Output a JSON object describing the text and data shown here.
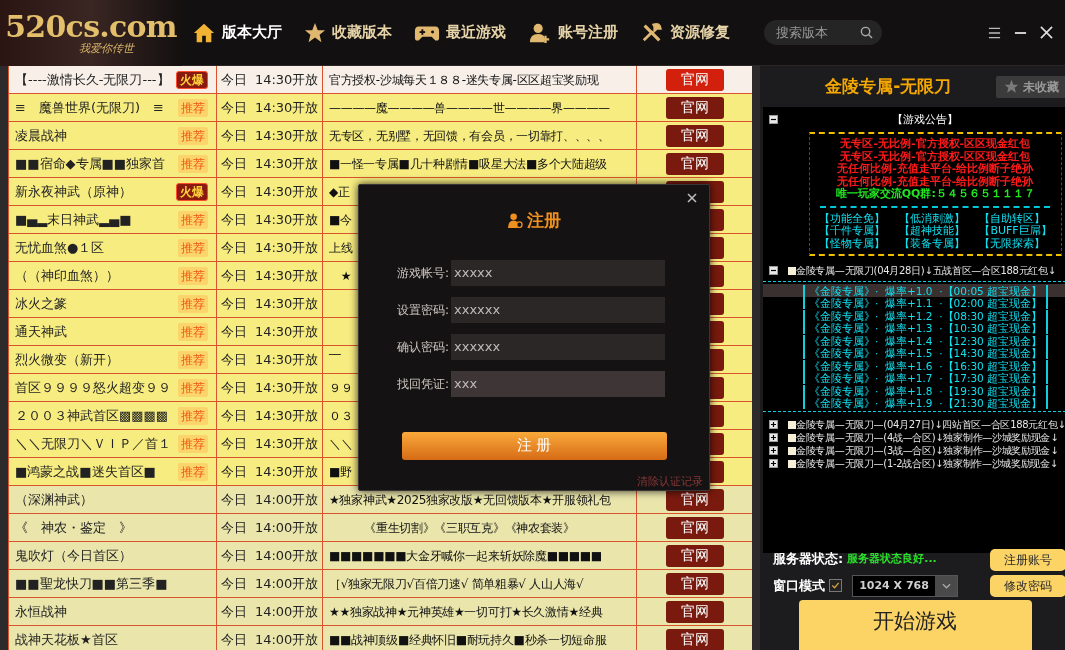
{
  "header": {
    "logo": {
      "text": "520cs.com",
      "tagline": "我爱你传世"
    },
    "nav": [
      {
        "label": "版本大厅",
        "selected": true
      },
      {
        "label": "收藏版本",
        "selected": false
      },
      {
        "label": "最近游戏",
        "selected": false
      },
      {
        "label": "账号注册",
        "selected": false
      },
      {
        "label": "资源修复",
        "selected": false
      }
    ],
    "search": {
      "placeholder": "搜索版本"
    }
  },
  "servers": [
    {
      "name": "【----激情长久-无限刀---】",
      "badge": {
        "kind": "hot",
        "text": "火爆"
      },
      "time": "今日  14:30开放",
      "desc": "官方授权-沙城每天１８８-迷失专属-区区超宝奖励现",
      "button": "官网",
      "selected": true
    },
    {
      "name": "≡　魔兽世界(无限刀)　≡",
      "badge": {
        "kind": "recommended",
        "text": "推荐"
      },
      "time": "今日  14:30开放",
      "desc": "————魔————兽————世————界————",
      "button": "官网",
      "selected": false
    },
    {
      "name": "凌晨战神",
      "badge": {
        "kind": "recommended",
        "text": "推荐"
      },
      "time": "今日  14:30开放",
      "desc": "无专区，无别墅，无回馈，有会员，一切靠打、、、、",
      "button": "官网",
      "selected": false
    },
    {
      "name": "■■宿命◆专属■■独家首",
      "badge": {
        "kind": "recommended",
        "text": "推荐"
      },
      "time": "今日  14:30开放",
      "desc": "■一怪一专属■几十种剧情■吸星大法■多个大陆超级",
      "button": "官网",
      "selected": false
    },
    {
      "name": "新永夜神武（原神）",
      "badge": {
        "kind": "hot",
        "text": "火爆"
      },
      "time": "今日  14:30开放",
      "desc": "◆正",
      "selected": false
    },
    {
      "name": "■▄▂末日神武▂▄■",
      "badge": {
        "kind": "recommended",
        "text": "推荐"
      },
      "time": "今日  14:30开放",
      "desc": "■今",
      "selected": false
    },
    {
      "name": "无忧血煞●１区",
      "badge": {
        "kind": "recommended",
        "text": "推荐"
      },
      "time": "今日  14:30开放",
      "desc": "上线",
      "selected": false
    },
    {
      "name": "（（神印血煞））",
      "badge": {
        "kind": "recommended",
        "text": "推荐"
      },
      "time": "今日  14:30开放",
      "desc": "　★",
      "selected": false
    },
    {
      "name": "冰火之篆",
      "badge": {
        "kind": "recommended",
        "text": "推荐"
      },
      "time": "今日  14:30开放",
      "selected": false
    },
    {
      "name": "通天神武",
      "badge": {
        "kind": "recommended",
        "text": "推荐"
      },
      "time": "今日  14:30开放",
      "selected": false
    },
    {
      "name": "烈火微变（新开）",
      "badge": {
        "kind": "recommended",
        "text": "推荐"
      },
      "time": "今日  14:30开放",
      "desc": "‾‾",
      "selected": false
    },
    {
      "name": "首区９９９９怒火超变９９",
      "badge": {
        "kind": "recommended",
        "text": "推荐"
      },
      "time": "今日  14:30开放",
      "desc": "９９",
      "selected": false
    },
    {
      "name": "２００３神武首区▩▩▩▩",
      "badge": {
        "kind": "recommended",
        "text": "推荐"
      },
      "time": "今日  14:30开放",
      "desc": "０３",
      "selected": false
    },
    {
      "name": "＼＼无限刀＼ＶＩＰ／首１",
      "badge": {
        "kind": "recommended",
        "text": "推荐"
      },
      "time": "今日  14:30开放",
      "desc": "＼＼",
      "selected": false
    },
    {
      "name": "■鸿蒙之战■迷失首区■",
      "badge": {
        "kind": "recommended",
        "text": "推荐"
      },
      "time": "今日  14:30开放",
      "desc": "■野",
      "selected": false
    },
    {
      "name": "（深渊神武）",
      "time": "今日  14:00开放",
      "desc": "★独家神武★2025独家改版★无回馈版本★开服领礼包",
      "button": "官网",
      "selected": false
    },
    {
      "name": "《　神农・鉴定　》",
      "time": "今日  14:00开放",
      "desc": "　　　《重生切割》《三职互克》《神农套装》",
      "button": "官网",
      "selected": false
    },
    {
      "name": "鬼吹灯（今日首区）",
      "time": "今日  14:00开放",
      "desc": "■■■■■■■大金牙喊你一起来斩妖除魔■■■■■",
      "button": "官网",
      "selected": false
    },
    {
      "name": "■■聖龙快刀■■第三季■",
      "time": "今日  14:00开放",
      "desc": "［√独家无限刀√百倍刀速√ 简单粗暴√ 人山人海√",
      "button": "官网",
      "selected": false
    },
    {
      "name": "永恒战神",
      "time": "今日  14:00开放",
      "desc": "★★独家战神★元神英雄★一切可打★长久激情★经典",
      "button": "官网",
      "selected": false
    },
    {
      "name": "战神天花板★首区",
      "time": "今日  14:00开放",
      "desc": "■■战神顶级■经典怀旧■耐玩持久■秒杀一切短命服",
      "button": "官网",
      "selected": false
    }
  ],
  "register_dialog": {
    "title": "注册",
    "fields": [
      {
        "label": "游戏帐号:",
        "value": "xxxxx",
        "focused": false
      },
      {
        "label": "设置密码:",
        "value": "xxxxxx",
        "focused": false
      },
      {
        "label": "确认密码:",
        "value": "xxxxxx",
        "focused": false
      },
      {
        "label": "找回凭证:",
        "value": "xxx",
        "focused": true
      }
    ],
    "submit": "注 册",
    "clear_link": "清除认证记录"
  },
  "game": {
    "title": "金陵专属-无限刀",
    "favorite": {
      "label": "未收藏",
      "favorited": false
    },
    "notice": [
      {
        "kind": "announcement",
        "label": "【游戏公告】",
        "expanded": true,
        "lines": [
          {
            "text": "无专区-无比例-官方授权-区区现金红包",
            "color": "#ff1a1a"
          },
          {
            "text": "无专区-无比例-官方授权-区区现金红包",
            "color": "#ff1a1a"
          },
          {
            "text": "无任何比例-充值走平台-给比例断子绝孙",
            "color": "#ff1a1a"
          },
          {
            "text": "无任何比例-充值走平台-给比例断子绝孙",
            "color": "#ff1a1a"
          },
          {
            "text": "唯一玩家交流QQ群:５４５６５１１１７",
            "color": "#22e622"
          }
        ],
        "tags": [
          "【功能全免】",
          "【低消刺激】",
          "【自助转区】",
          "【千件专属】",
          "【超神技能】",
          "【BUFF巨屌】",
          "【怪物专属】",
          "【装备专属】",
          "【无限探索】"
        ]
      },
      {
        "kind": "schedule",
        "label": "金陵专属—无限刀(04月28日)↓五战首区—合区188元红包↓",
        "expanded": true,
        "rows": [
          {
            "text": "《金陵专属》·  爆率+1.0  ·【00:05 超宝现金】",
            "selected": true
          },
          {
            "text": "《金陵专属》·  爆率+1.1  ·【02:00 超宝现金】",
            "selected": false
          },
          {
            "text": "《金陵专属》·  爆率+1.2  ·【08:30 超宝现金】",
            "selected": false
          },
          {
            "text": "《金陵专属》·  爆率+1.3  ·【10:30 超宝现金】",
            "selected": false
          },
          {
            "text": "《金陵专属》·  爆率+1.4  ·【12:30 超宝现金】",
            "selected": false
          },
          {
            "text": "《金陵专属》·  爆率+1.5  ·【14:30 超宝现金】",
            "selected": false
          },
          {
            "text": "《金陵专属》·  爆率+1.6  ·【16:30 超宝现金】",
            "selected": false
          },
          {
            "text": "《金陵专属》·  爆率+1.7  ·【17:30 超宝现金】",
            "selected": false
          },
          {
            "text": "《金陵专属》·  爆率+1.8  ·【19:30 超宝现金】",
            "selected": false
          },
          {
            "text": "《金陵专属》·  爆率+1.9  ·【21:30 超宝现金】",
            "selected": false
          }
        ]
      },
      {
        "kind": "plain",
        "label": "金陵专属—无限刀—(04月27日)↓四站首区—合区188元红包↓",
        "expanded": false
      },
      {
        "kind": "plain",
        "label": "金陵专属—无限刀—(4战—合区)↓独家制作—沙城奖励现金↓",
        "expanded": false
      },
      {
        "kind": "plain",
        "label": "金陵专属—无限刀—(3战—合区)↓独家制作—沙城奖励现金↓",
        "expanded": false
      },
      {
        "kind": "plain",
        "label": "金陵专属—无限刀—(1-2战合区)↓独家制作—沙城奖励现金↓",
        "expanded": false
      }
    ],
    "server_status": {
      "label": "服务器状态:",
      "value": "服务器状态良好..."
    },
    "window_mode": {
      "label": "窗口模式",
      "checked": true,
      "resolution": "1024 X 768"
    },
    "buttons": [
      "注册账号",
      "修改密码"
    ],
    "start": "开始游戏"
  }
}
